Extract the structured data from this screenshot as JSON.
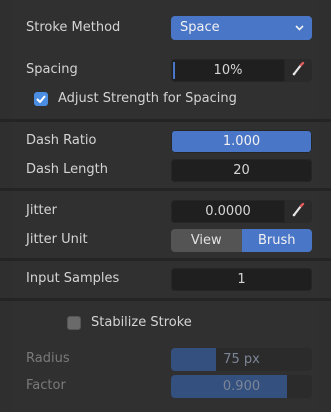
{
  "stroke": {
    "method_label": "Stroke Method",
    "method_value": "Space",
    "spacing_label": "Spacing",
    "spacing_value": "10%",
    "adjust_label": "Adjust Strength for Spacing",
    "adjust_checked": true
  },
  "dash": {
    "ratio_label": "Dash Ratio",
    "ratio_value": "1.000",
    "length_label": "Dash Length",
    "length_value": "20"
  },
  "jitter": {
    "label": "Jitter",
    "value": "0.0000",
    "unit_label": "Jitter Unit",
    "unit_options": [
      "View",
      "Brush"
    ],
    "unit_selected": "Brush"
  },
  "input": {
    "samples_label": "Input Samples",
    "samples_value": "1"
  },
  "stabilize": {
    "label": "Stabilize Stroke",
    "checked": false,
    "radius_label": "Radius",
    "radius_value": "75 px",
    "radius_fraction": 0.32,
    "factor_label": "Factor",
    "factor_value": "0.900",
    "factor_fraction": 0.82
  },
  "colors": {
    "accent": "#4a76c7",
    "checkbox_on": "#4a8de2",
    "panel": "#303030"
  }
}
